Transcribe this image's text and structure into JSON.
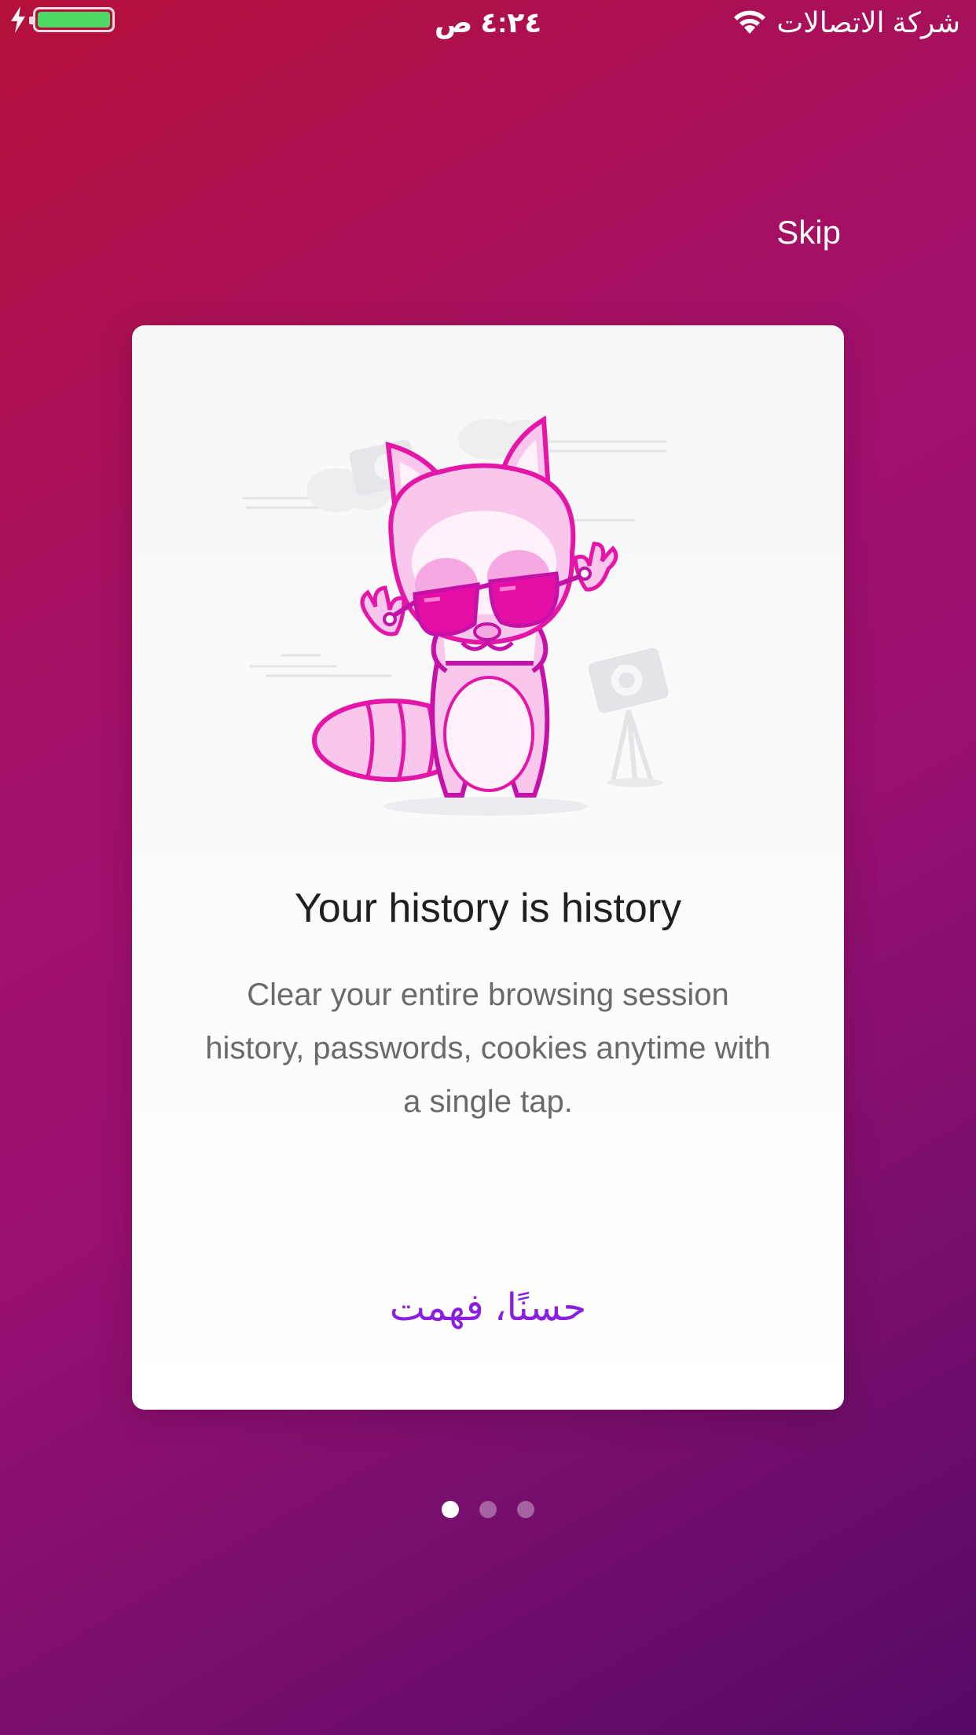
{
  "status_bar": {
    "carrier": "شركة الاتصالات",
    "time": "٤:٢٤ ص",
    "battery_color": "#4cd964"
  },
  "header": {
    "skip_label": "Skip"
  },
  "card": {
    "title": "Your history is history",
    "body": "Clear your entire browsing session history, passwords, cookies anytime with a single tap.",
    "cta_label": "حسنًا، فهمت",
    "cta_color": "#8a1fe0",
    "illustration": "raccoon-with-sunglasses"
  },
  "pagination": {
    "total_pages": 3,
    "current_page": 1
  },
  "icons": [
    "charging-bolt-icon",
    "battery-icon",
    "wifi-icon"
  ]
}
